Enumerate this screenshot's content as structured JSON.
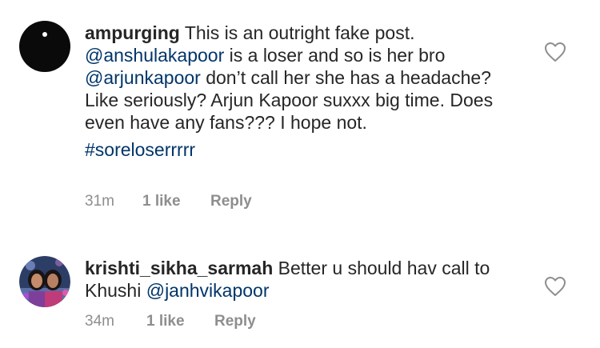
{
  "comments": [
    {
      "username": "ampurging",
      "text_parts": [
        {
          "type": "text",
          "value": "This is an outright fake post. "
        },
        {
          "type": "mention",
          "value": "@anshulakapoor"
        },
        {
          "type": "text",
          "value": " is a loser and so is her bro "
        },
        {
          "type": "mention",
          "value": "@arjunkapoor"
        },
        {
          "type": "text",
          "value": " don’t call her she has a headache? Like seriously? Arjun Kapoor suxxx big time. Does even have any fans??? I hope not."
        }
      ],
      "hashtag": "#soreloserrrrr",
      "time": "31m",
      "likes": "1 like",
      "reply_label": "Reply"
    },
    {
      "username": "krishti_sikha_sarmah",
      "text_parts": [
        {
          "type": "text",
          "value": "Better u should hav call to Khushi "
        },
        {
          "type": "mention",
          "value": "@janhvikapoor"
        }
      ],
      "time": "34m",
      "likes": "1 like",
      "reply_label": "Reply"
    }
  ],
  "icons": {
    "like": "heart-outline-icon"
  },
  "colors": {
    "text": "#262626",
    "mention": "#003569",
    "meta": "#8e8e8e"
  }
}
